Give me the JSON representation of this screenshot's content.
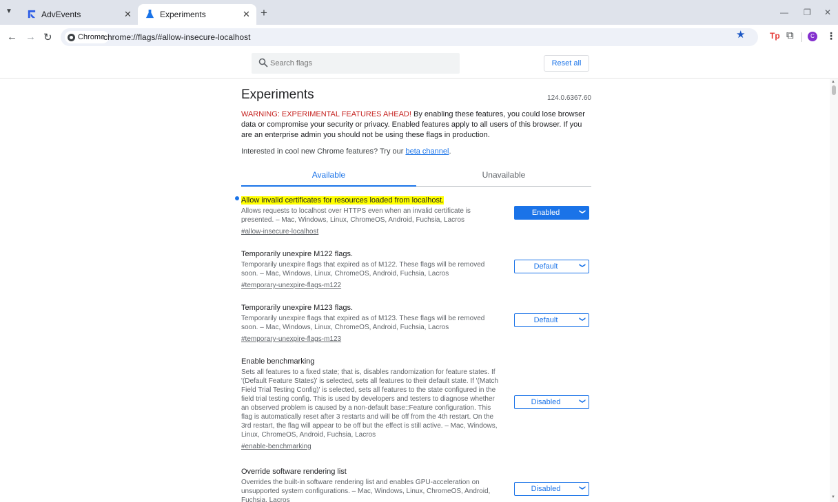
{
  "tabs": [
    {
      "title": "AdvEvents",
      "active": false
    },
    {
      "title": "Experiments",
      "active": true
    }
  ],
  "toolbar": {
    "site_chip": "Chrome",
    "url": "chrome://flags/#allow-insecure-localhost",
    "profile_initial": "C",
    "ext_tp": "Tp"
  },
  "header": {
    "search_placeholder": "Search flags",
    "reset_label": "Reset all"
  },
  "page": {
    "title": "Experiments",
    "version": "124.0.6367.60",
    "warning_red": "WARNING: EXPERIMENTAL FEATURES AHEAD!",
    "warning_rest": " By enabling these features, you could lose browser data or compromise your security or privacy. Enabled features apply to all users of this browser. If you are an enterprise admin you should not be using these flags in production.",
    "beta_prefix": "Interested in cool new Chrome features? Try our ",
    "beta_link": "beta channel",
    "beta_suffix": ".",
    "tab_available": "Available",
    "tab_unavailable": "Unavailable"
  },
  "flags": [
    {
      "name": "Allow invalid certificates for resources loaded from localhost.",
      "desc": "Allows requests to localhost over HTTPS even when an invalid certificate is presented. – Mac, Windows, Linux, ChromeOS, Android, Fuchsia, Lacros",
      "link": "#allow-insecure-localhost",
      "value": "Enabled",
      "highlighted": true
    },
    {
      "name": "Temporarily unexpire M122 flags.",
      "desc": "Temporarily unexpire flags that expired as of M122. These flags will be removed soon. – Mac, Windows, Linux, ChromeOS, Android, Fuchsia, Lacros",
      "link": "#temporary-unexpire-flags-m122",
      "value": "Default"
    },
    {
      "name": "Temporarily unexpire M123 flags.",
      "desc": "Temporarily unexpire flags that expired as of M123. These flags will be removed soon. – Mac, Windows, Linux, ChromeOS, Android, Fuchsia, Lacros",
      "link": "#temporary-unexpire-flags-m123",
      "value": "Default"
    },
    {
      "name": "Enable benchmarking",
      "desc": "Sets all features to a fixed state; that is, disables randomization for feature states. If '(Default Feature States)' is selected, sets all features to their default state. If '(Match Field Trial Testing Config)' is selected, sets all features to the state configured in the field trial testing config. This is used by developers and testers to diagnose whether an observed problem is caused by a non-default base::Feature configuration. This flag is automatically reset after 3 restarts and will be off from the 4th restart. On the 3rd restart, the flag will appear to be off but the effect is still active. – Mac, Windows, Linux, ChromeOS, Android, Fuchsia, Lacros",
      "link": "#enable-benchmarking",
      "value": "Disabled"
    },
    {
      "name": "Override software rendering list",
      "desc": "Overrides the built-in software rendering list and enables GPU-acceleration on unsupported system configurations. – Mac, Windows, Linux, ChromeOS, Android, Fuchsia, Lacros",
      "link": "",
      "value": "Disabled"
    }
  ],
  "colors": {
    "accent": "#1a73e8",
    "warning": "#c5221f",
    "highlight": "#ffff00"
  }
}
